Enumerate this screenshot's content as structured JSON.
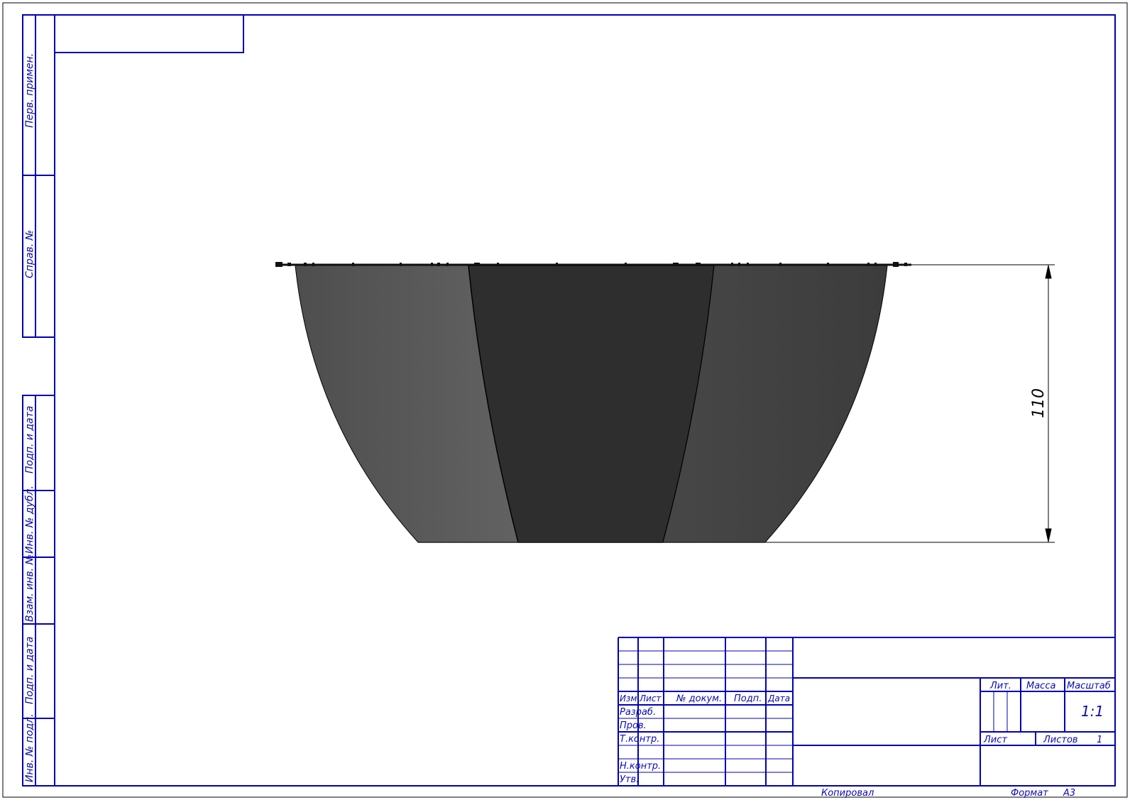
{
  "colors": {
    "frame": "#0000b4",
    "outline": "#000000",
    "shade_left": "#595959",
    "shade_center": "#2e2e2e",
    "shade_right": "#434343"
  },
  "side_strip": {
    "top": [
      "Перв. примен.",
      "Справ. №"
    ],
    "bottom": [
      "Подп. и дата",
      "Инв. № дубл.",
      "Взам. инв. №",
      "Подп. и дата",
      "Инв. № подл."
    ]
  },
  "drawing": {
    "dimension_value": "110"
  },
  "title_block": {
    "col_headers": [
      "Изм.",
      "Лист",
      "№ докум.",
      "Подп.",
      "Дата"
    ],
    "rows": [
      "Разраб.",
      "Пров.",
      "Т.контр.",
      "",
      "Н.контр.",
      "Утв."
    ],
    "lit_label": "Лит.",
    "mass_label": "Масса",
    "scale_label": "Масштаб",
    "scale_value": "1:1",
    "sheet_label": "Лист",
    "sheets_label": "Листов",
    "sheets_value": "1"
  },
  "footer": {
    "copied": "Копировал",
    "format_label": "Формат",
    "format_value": "А3"
  }
}
